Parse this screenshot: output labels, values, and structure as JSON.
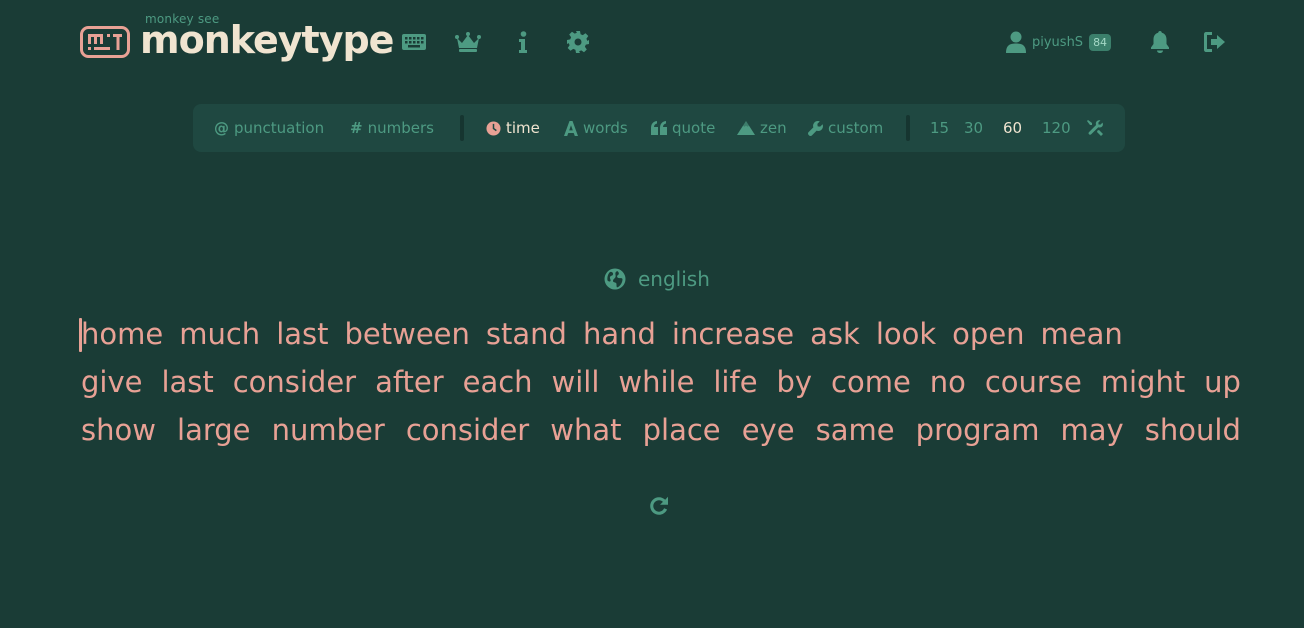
{
  "header": {
    "logo_sub": "monkey see",
    "logo_text": "monkeytype",
    "nav": [
      {
        "name": "keyboard-icon"
      },
      {
        "name": "crown-icon"
      },
      {
        "name": "info-icon"
      },
      {
        "name": "gear-icon"
      }
    ],
    "account": {
      "username": "piyushS",
      "level": "84"
    }
  },
  "config": {
    "punctuation": "punctuation",
    "numbers": "numbers",
    "modes": {
      "time": "time",
      "words": "words",
      "quote": "quote",
      "zen": "zen",
      "custom": "custom"
    },
    "active_mode": "time",
    "durations": [
      "15",
      "30",
      "60",
      "120"
    ],
    "active_duration": "60"
  },
  "language": "english",
  "test": {
    "lines": [
      [
        "home",
        "much",
        "last",
        "between",
        "stand",
        "hand",
        "increase",
        "ask",
        "look",
        "open",
        "mean"
      ],
      [
        "give",
        "last",
        "consider",
        "after",
        "each",
        "will",
        "while",
        "life",
        "by",
        "come",
        "no",
        "course",
        "might",
        "up"
      ],
      [
        "show",
        "large",
        "number",
        "consider",
        "what",
        "place",
        "eye",
        "same",
        "program",
        "may",
        "should"
      ]
    ]
  },
  "colors": {
    "background": "#1a3c36",
    "main": "#e8a195",
    "sub": "#4d9a82",
    "text": "#f0e4d0"
  }
}
